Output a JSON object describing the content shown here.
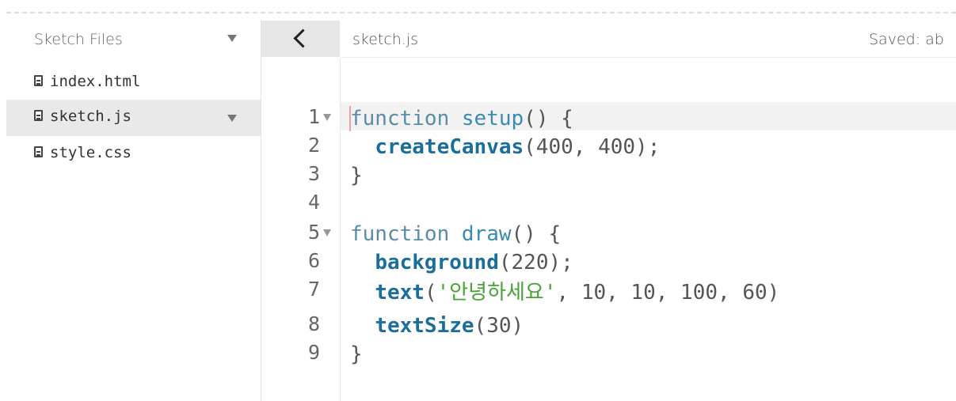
{
  "sidebar": {
    "title": "Sketch Files",
    "files": [
      {
        "name": "index.html",
        "active": false
      },
      {
        "name": "sketch.js",
        "active": true
      },
      {
        "name": "style.css",
        "active": false
      }
    ]
  },
  "editor": {
    "tab_name": "sketch.js",
    "save_status": "Saved: ab",
    "lines": [
      {
        "number": "1",
        "kw": "function",
        "name": "setup",
        "rest": "() {"
      },
      {
        "number": "2",
        "indent": "  ",
        "call": "createCanvas",
        "args": "(400, 400);"
      },
      {
        "number": "3",
        "text": "}"
      },
      {
        "number": "4",
        "text": ""
      },
      {
        "number": "5",
        "kw": "function",
        "name": "draw",
        "rest": "() {"
      },
      {
        "number": "6",
        "indent": "  ",
        "call": "background",
        "args": "(220);"
      },
      {
        "number": "7",
        "indent": "  ",
        "call": "text",
        "open": "(",
        "string": "'안녕하세요'",
        "args": ", 10, 10, 100, 60)"
      },
      {
        "number": "8",
        "indent": "  ",
        "call": "textSize",
        "args": "(30)"
      },
      {
        "number": "9",
        "text": "}"
      }
    ]
  }
}
